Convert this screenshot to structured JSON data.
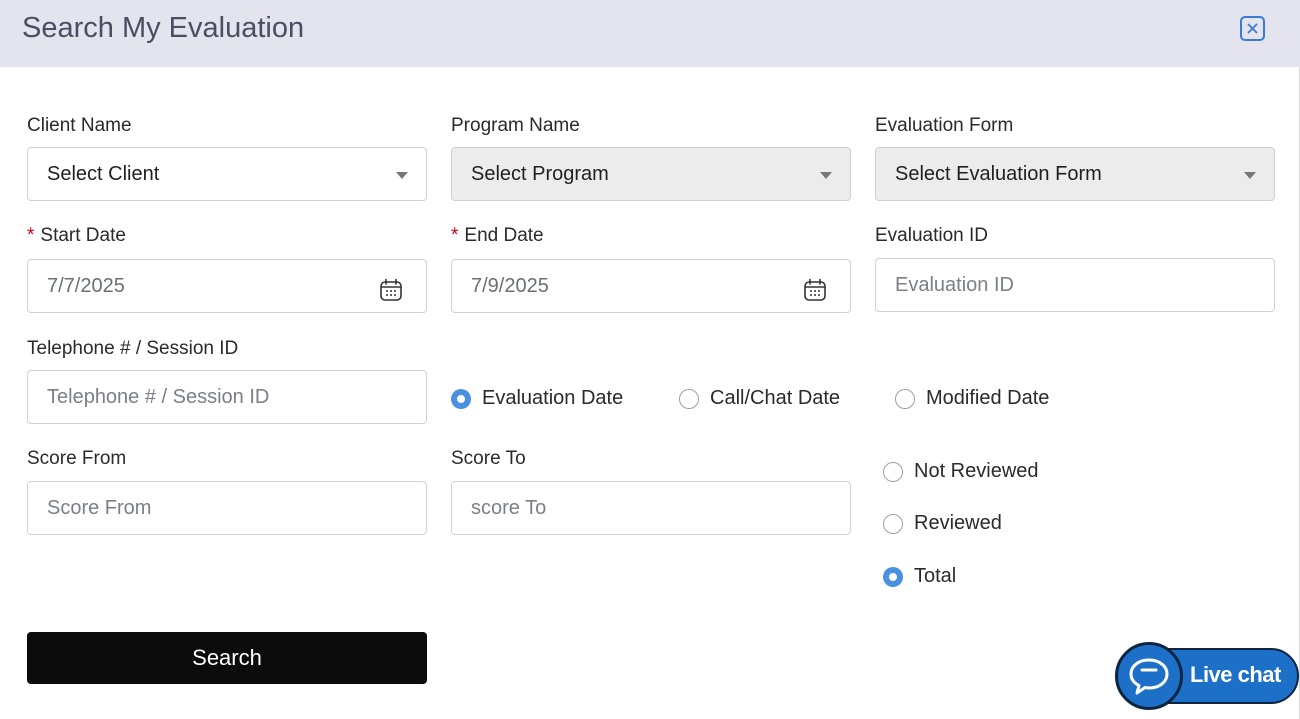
{
  "modal": {
    "title": "Search My Evaluation"
  },
  "fields": {
    "client_name": {
      "label": "Client Name",
      "value": "Select Client"
    },
    "program_name": {
      "label": "Program Name",
      "value": "Select Program"
    },
    "evaluation_form": {
      "label": "Evaluation Form",
      "value": "Select Evaluation Form"
    },
    "start_date": {
      "required_mark": "*",
      "label": "Start Date",
      "value": "7/7/2025"
    },
    "end_date": {
      "required_mark": "*",
      "label": "End Date",
      "value": "7/9/2025"
    },
    "evaluation_id": {
      "label": "Evaluation ID",
      "placeholder": "Evaluation ID"
    },
    "telephone": {
      "label": "Telephone # / Session ID",
      "placeholder": "Telephone # / Session ID"
    },
    "score_from": {
      "label": "Score From",
      "placeholder": "Score From"
    },
    "score_to": {
      "label": "Score To",
      "placeholder": "score To"
    }
  },
  "date_type_options": [
    {
      "label": "Evaluation Date",
      "selected": true
    },
    {
      "label": "Call/Chat Date",
      "selected": false
    },
    {
      "label": "Modified Date",
      "selected": false
    }
  ],
  "review_options": [
    {
      "label": "Not Reviewed",
      "selected": false
    },
    {
      "label": "Reviewed",
      "selected": false
    },
    {
      "label": "Total",
      "selected": true
    }
  ],
  "search_button": {
    "label": "Search"
  },
  "live_chat": {
    "label": "Live chat"
  },
  "icons": {
    "close": "close-x-icon",
    "calendar": "calendar-icon",
    "dropdown": "caret-down-icon",
    "chat": "chat-bubble-icon"
  },
  "colors": {
    "header_bg": "#e4e4ee",
    "accent": "#4a90e2",
    "required": "#d0021b",
    "button_bg": "#0b0b0b",
    "live_chat": "#1c70c8"
  }
}
